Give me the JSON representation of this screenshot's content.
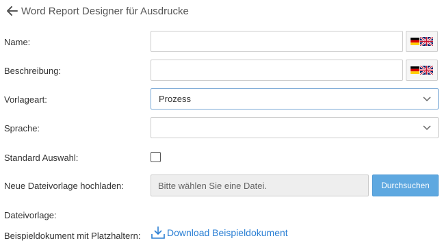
{
  "header": {
    "title": "Word Report Designer für Ausdrucke"
  },
  "form": {
    "name_label": "Name:",
    "name_value": "",
    "description_label": "Beschreibung:",
    "description_value": "",
    "template_type_label": "Vorlageart:",
    "template_type_value": "Prozess",
    "language_label": "Sprache:",
    "language_value": "",
    "default_selection_label": "Standard Auswahl:",
    "default_selection_checked": false,
    "upload_label": "Neue Dateivorlage hochladen:",
    "upload_placeholder": "Bitte wählen Sie eine Datei.",
    "browse_label": "Durchsuchen",
    "template_file_label": "Dateivorlage:",
    "sample_doc_label": "Beispieldokument mit Platzhaltern:",
    "download_label": "Download Beispieldokument"
  },
  "icons": {
    "back": "arrow-left-icon",
    "flag": "de-uk-flag-icon",
    "caret": "caret-down-icon",
    "download": "download-tray-icon"
  },
  "colors": {
    "accent": "#5ea8e0",
    "link": "#2a7fd4",
    "focus_border": "#7aa9d6"
  }
}
